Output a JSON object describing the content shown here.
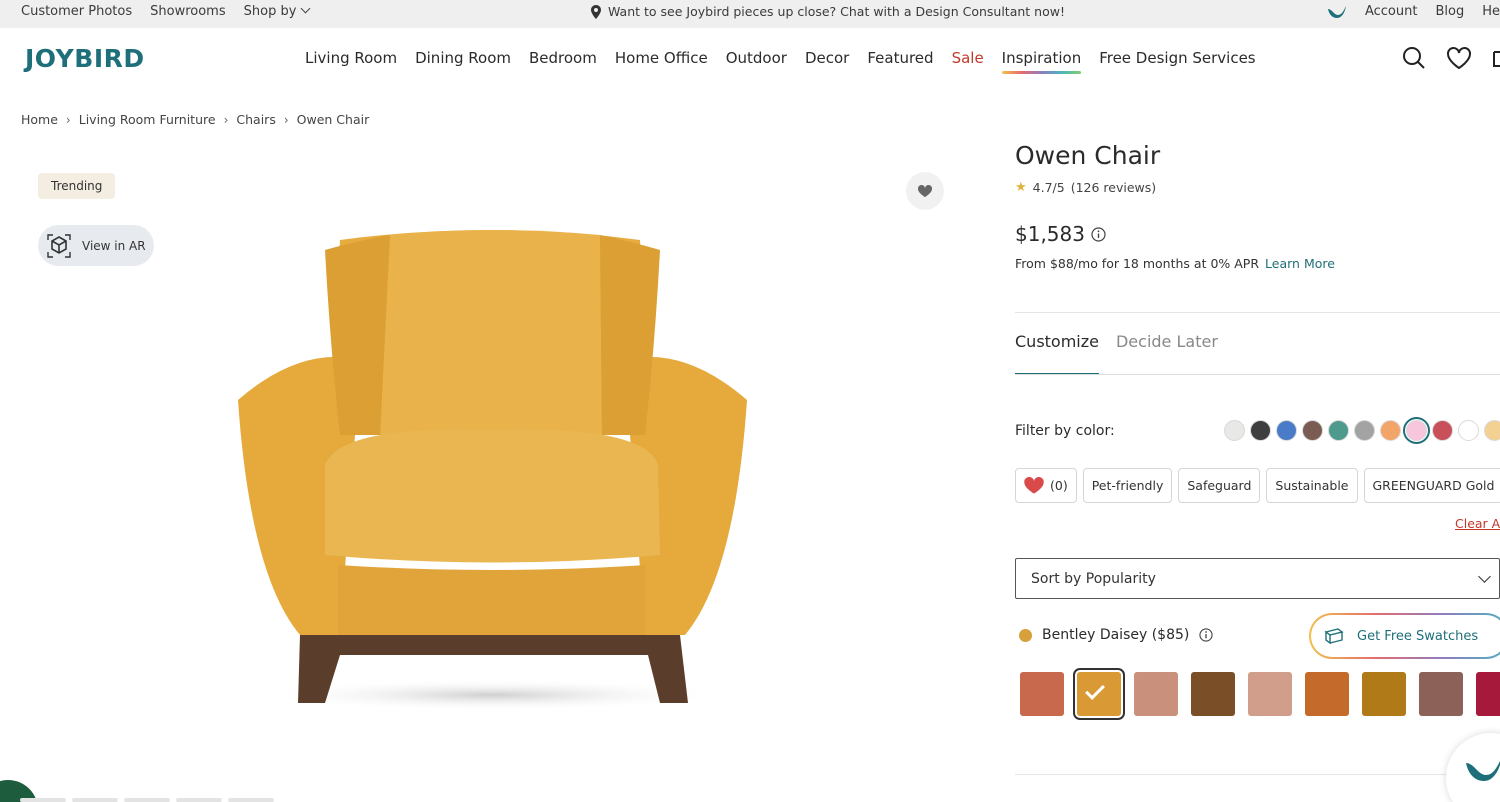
{
  "topbar": {
    "links_left": [
      "Customer Photos",
      "Showrooms"
    ],
    "shop_by": "Shop by",
    "announcement": "Want to see Joybird pieces up close? Chat with a Design Consultant now!",
    "links_right": [
      "Account",
      "Blog"
    ],
    "partial_right": "He"
  },
  "nav": {
    "logo": "JOYBIRD",
    "items": [
      "Living Room",
      "Dining Room",
      "Bedroom",
      "Home Office",
      "Outdoor",
      "Decor",
      "Featured"
    ],
    "sale": "Sale",
    "inspiration": "Inspiration",
    "design_services": "Free Design Services"
  },
  "breadcrumb": [
    "Home",
    "Living Room Furniture",
    "Chairs",
    "Owen Chair"
  ],
  "gallery": {
    "badge": "Trending",
    "ar_label": "View in AR"
  },
  "product": {
    "title": "Owen Chair",
    "rating": "4.7/5",
    "reviews": "(126 reviews)",
    "price": "$1,583",
    "financing": "From $88/mo for 18 months at 0% APR",
    "learn_more": "Learn More"
  },
  "tabs": [
    "Customize",
    "Decide Later"
  ],
  "filters": {
    "label": "Filter by color:",
    "colors": [
      "#e8e8e6",
      "#3e3e3e",
      "#4a7bc9",
      "#7a5c52",
      "#4e9a8c",
      "#a3a3a3",
      "#f3a468",
      "#f7c6dc",
      "#c9505a",
      "#ffffff",
      "#f3d193"
    ],
    "chips": [
      "(0)",
      "Pet-friendly",
      "Safeguard",
      "Sustainable",
      "GREENGUARD Gold"
    ],
    "clear": "Clear A"
  },
  "sort": {
    "label": "Sort by Popularity"
  },
  "fabric": {
    "name": "Bentley Daisey ($85)",
    "free_swatches": "Get Free Swatches",
    "swatches": [
      "#c8694e",
      "#d99a36",
      "#c9907c",
      "#7a4f28",
      "#d29e8c",
      "#c46a2a",
      "#b17a19",
      "#8b6158",
      "#a7193a"
    ],
    "selected_index": 1
  }
}
